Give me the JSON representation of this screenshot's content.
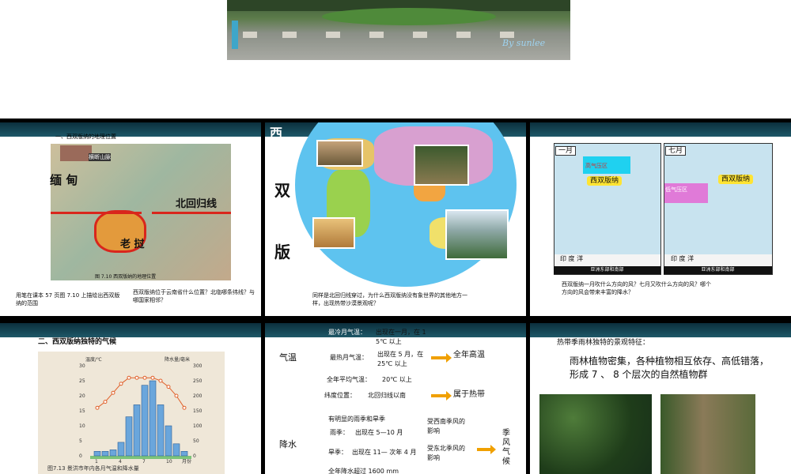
{
  "hero": {
    "watermark": "By sunlee"
  },
  "slide1": {
    "title": "一、西双版纳的地理位置",
    "label_myanmar": "缅 甸",
    "label_tropic": "北回归线",
    "label_laos": "老 挝",
    "label_mountain": "横断山脉",
    "map_caption": "图 7.10 西双版纳的地理位置",
    "caption_left": "用笔在课本 57 页图 7.10 上描绘出西双版纳的范围",
    "caption_right": "西双版纳位于云南省什么位置？北临哪条纬线？与哪国家相邻？"
  },
  "slide2": {
    "title_chars": [
      "西",
      "双",
      "版"
    ],
    "caption": "同样是北回归线穿过，为什么西双版纳没有象世界的其他地方一样，出现热带沙漠景观呢？"
  },
  "slide3": {
    "jan_label": "一月",
    "jul_label": "七月",
    "high_pressure": "高气压区",
    "low_pressure": "低气压区",
    "xsbn_left": "西双版纳",
    "xsbn_right": "西双版纳",
    "sea_left": "印 度 洋",
    "sea_right": "印 度 洋",
    "region_left": "亚洲东部和南部",
    "region_right": "亚洲东部和南部",
    "caption": "西双版纳一月吹什么方向的风？七月又吹什么方向的风？哪个方向的风会带来丰富的降水？"
  },
  "slide4": {
    "title": "二、西双版纳独特的气候",
    "y_left_label": "温度/℃",
    "y_right_label": "降水量/毫米",
    "y_left_ticks": [
      "30",
      "25",
      "20",
      "15",
      "10",
      "5",
      "0"
    ],
    "y_right_ticks": [
      "300",
      "250",
      "200",
      "150",
      "100",
      "50",
      "0"
    ],
    "x_ticks": [
      "1",
      "4",
      "7",
      "10",
      "月份"
    ],
    "fig_caption": "图7.13 景洪市年内各月气温和降水量"
  },
  "slide5": {
    "temp_header": "气温",
    "coldest": "最冷月气温：",
    "coldest_val": "出现在一月，在 1 5℃ 以上",
    "hottest": "最热月气温：",
    "hottest_val": "出现在 5 月，在 25℃ 以上",
    "annual_high": "全年高温",
    "annual_avg": "全年平均气温：",
    "annual_avg_val": "20℃ 以上",
    "latitude": "纬度位置：",
    "latitude_val": "北回归线以南",
    "tropic_zone": "属于热带",
    "precip_header": "降水",
    "seasons": "有明显的雨季和旱季",
    "rainy": "雨季：",
    "rainy_val": "出现在 5—10 月",
    "rainy_cause": "受西南季风的影响",
    "dry": "旱季：",
    "dry_val": "出现在 11— 次年 4 月",
    "dry_cause": "受东北季风的影响",
    "monsoon": "季风气候",
    "annual_precip": "全年降水超过 1600 mm"
  },
  "slide6": {
    "title": "热带季雨林独特的景观特征：",
    "body": "雨林植物密集，各种植物相互依存、高低错落，形成 7 、 8 个层次的自然植物群"
  },
  "chart_data": {
    "type": "bar",
    "title": "图7.13 景洪市年内各月气温和降水量",
    "xlabel": "月份",
    "ylabel": "温度/℃",
    "ylabel_right": "降水量/毫米",
    "categories": [
      "1",
      "2",
      "3",
      "4",
      "5",
      "6",
      "7",
      "8",
      "9",
      "10",
      "11",
      "12"
    ],
    "series": [
      {
        "name": "降水量/毫米",
        "values": [
          15,
          15,
          20,
          45,
          130,
          170,
          235,
          250,
          170,
          100,
          40,
          15
        ]
      },
      {
        "name": "温度/℃",
        "values": [
          16,
          18,
          21,
          24,
          26,
          26,
          26,
          26,
          25,
          23,
          20,
          16
        ]
      }
    ],
    "ylim": [
      0,
      30
    ],
    "ylim_right": [
      0,
      300
    ]
  }
}
